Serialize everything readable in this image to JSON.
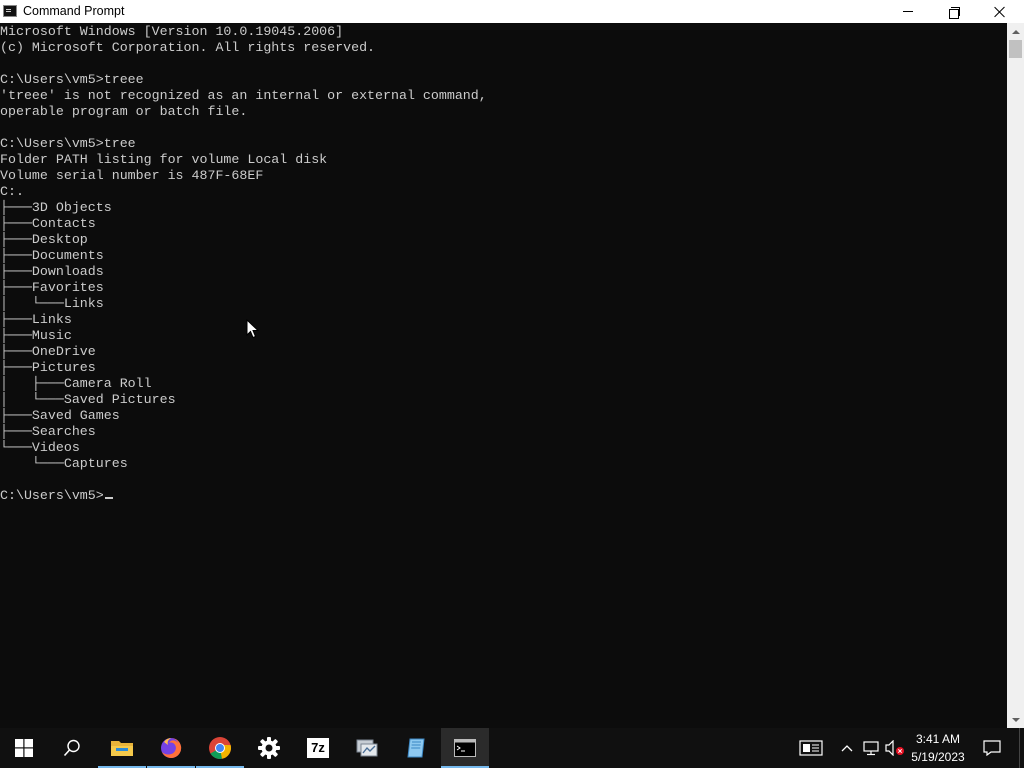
{
  "window": {
    "title": "Command Prompt",
    "minimize_label": "Minimize",
    "maximize_label": "Restore Down",
    "close_label": "Close"
  },
  "console": {
    "lines": [
      "Microsoft Windows [Version 10.0.19045.2006]",
      "(c) Microsoft Corporation. All rights reserved.",
      "",
      "C:\\Users\\vm5>treee",
      "'treee' is not recognized as an internal or external command,",
      "operable program or batch file.",
      "",
      "C:\\Users\\vm5>tree",
      "Folder PATH listing for volume Local disk",
      "Volume serial number is 487F-68EF",
      "C:.",
      "├───3D Objects",
      "├───Contacts",
      "├───Desktop",
      "├───Documents",
      "├───Downloads",
      "├───Favorites",
      "│   └───Links",
      "├───Links",
      "├───Music",
      "├───OneDrive",
      "├───Pictures",
      "│   ├───Camera Roll",
      "│   └───Saved Pictures",
      "├───Saved Games",
      "├───Searches",
      "└───Videos",
      "    └───Captures",
      ""
    ],
    "prompt": "C:\\Users\\vm5>"
  },
  "colors": {
    "console_bg": "#0c0c0c",
    "console_fg": "#cccccc",
    "taskbar_bg": "#101010",
    "active_indicator": "#76b9ed"
  },
  "taskbar": {
    "items": [
      {
        "name": "start",
        "icon": "windows-logo-icon"
      },
      {
        "name": "search",
        "icon": "search-icon"
      },
      {
        "name": "file-explorer",
        "icon": "folder-icon"
      },
      {
        "name": "firefox",
        "icon": "firefox-icon"
      },
      {
        "name": "chrome",
        "icon": "chrome-icon"
      },
      {
        "name": "settings",
        "icon": "gear-icon"
      },
      {
        "name": "7-zip",
        "icon": "sevenzip-icon",
        "label": "7z"
      },
      {
        "name": "network-app",
        "icon": "network-app-icon"
      },
      {
        "name": "notepad-app",
        "icon": "notepad-icon"
      },
      {
        "name": "command-prompt",
        "icon": "cmd-icon",
        "active": true
      }
    ],
    "clock": {
      "time": "3:41 AM",
      "date": "5/19/2023"
    }
  }
}
